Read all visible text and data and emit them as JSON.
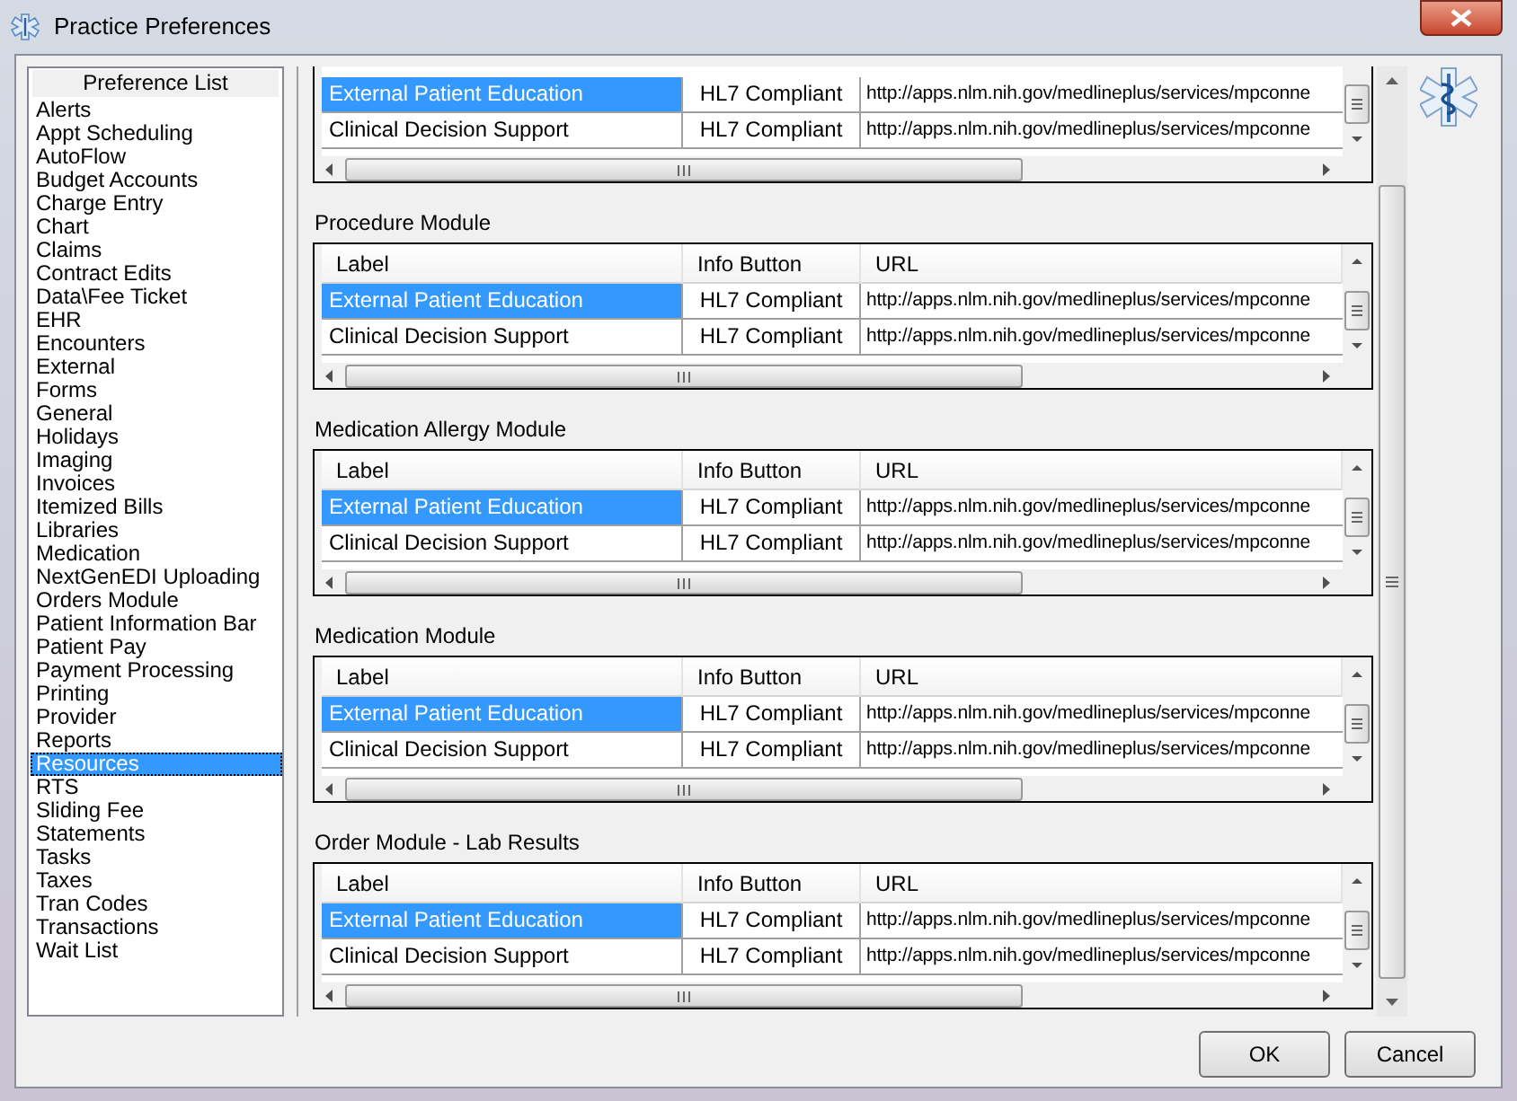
{
  "window": {
    "title": "Practice Preferences"
  },
  "preference_list": {
    "heading": "Preference List",
    "items": [
      {
        "label": "Alerts",
        "selected": false
      },
      {
        "label": "Appt Scheduling",
        "selected": false
      },
      {
        "label": "AutoFlow",
        "selected": false
      },
      {
        "label": "Budget Accounts",
        "selected": false
      },
      {
        "label": "Charge Entry",
        "selected": false
      },
      {
        "label": "Chart",
        "selected": false
      },
      {
        "label": "Claims",
        "selected": false
      },
      {
        "label": "Contract Edits",
        "selected": false
      },
      {
        "label": "Data\\Fee Ticket",
        "selected": false
      },
      {
        "label": "EHR",
        "selected": false
      },
      {
        "label": "Encounters",
        "selected": false
      },
      {
        "label": "External",
        "selected": false
      },
      {
        "label": "Forms",
        "selected": false
      },
      {
        "label": "General",
        "selected": false
      },
      {
        "label": "Holidays",
        "selected": false
      },
      {
        "label": "Imaging",
        "selected": false
      },
      {
        "label": "Invoices",
        "selected": false
      },
      {
        "label": "Itemized Bills",
        "selected": false
      },
      {
        "label": "Libraries",
        "selected": false
      },
      {
        "label": "Medication",
        "selected": false
      },
      {
        "label": "NextGenEDI Uploading",
        "selected": false
      },
      {
        "label": "Orders Module",
        "selected": false
      },
      {
        "label": "Patient Information Bar",
        "selected": false
      },
      {
        "label": "Patient Pay",
        "selected": false
      },
      {
        "label": "Payment Processing",
        "selected": false
      },
      {
        "label": "Printing",
        "selected": false
      },
      {
        "label": "Provider",
        "selected": false
      },
      {
        "label": "Reports",
        "selected": false
      },
      {
        "label": "Resources",
        "selected": true
      },
      {
        "label": "RTS",
        "selected": false
      },
      {
        "label": "Sliding Fee",
        "selected": false
      },
      {
        "label": "Statements",
        "selected": false
      },
      {
        "label": "Tasks",
        "selected": false
      },
      {
        "label": "Taxes",
        "selected": false
      },
      {
        "label": "Tran Codes",
        "selected": false
      },
      {
        "label": "Transactions",
        "selected": false
      },
      {
        "label": "Wait List",
        "selected": false
      }
    ]
  },
  "sections": [
    {
      "rows": [
        {
          "label": "External Patient Education",
          "info_button": "HL7 Compliant",
          "url": "http://apps.nlm.nih.gov/medlineplus/services/mpconne",
          "selected": true
        },
        {
          "label": "Clinical Decision Support",
          "info_button": "HL7 Compliant",
          "url": "http://apps.nlm.nih.gov/medlineplus/services/mpconne",
          "selected": false
        }
      ]
    },
    {
      "title": "Procedure Module",
      "columns": [
        "Label",
        "Info Button",
        "URL"
      ],
      "rows": [
        {
          "label": "External Patient Education",
          "info_button": "HL7 Compliant",
          "url": "http://apps.nlm.nih.gov/medlineplus/services/mpconne",
          "selected": true
        },
        {
          "label": "Clinical Decision Support",
          "info_button": "HL7 Compliant",
          "url": "http://apps.nlm.nih.gov/medlineplus/services/mpconne",
          "selected": false
        }
      ]
    },
    {
      "title": "Medication Allergy Module",
      "columns": [
        "Label",
        "Info Button",
        "URL"
      ],
      "rows": [
        {
          "label": "External Patient Education",
          "info_button": "HL7 Compliant",
          "url": "http://apps.nlm.nih.gov/medlineplus/services/mpconne",
          "selected": true
        },
        {
          "label": "Clinical Decision Support",
          "info_button": "HL7 Compliant",
          "url": "http://apps.nlm.nih.gov/medlineplus/services/mpconne",
          "selected": false
        }
      ]
    },
    {
      "title": "Medication Module",
      "columns": [
        "Label",
        "Info Button",
        "URL"
      ],
      "rows": [
        {
          "label": "External Patient Education",
          "info_button": "HL7 Compliant",
          "url": "http://apps.nlm.nih.gov/medlineplus/services/mpconne",
          "selected": true
        },
        {
          "label": "Clinical Decision Support",
          "info_button": "HL7 Compliant",
          "url": "http://apps.nlm.nih.gov/medlineplus/services/mpconne",
          "selected": false
        }
      ]
    },
    {
      "title": "Order Module - Lab Results",
      "columns": [
        "Label",
        "Info Button",
        "URL"
      ],
      "rows": [
        {
          "label": "External Patient Education",
          "info_button": "HL7 Compliant",
          "url": "http://apps.nlm.nih.gov/medlineplus/services/mpconne",
          "selected": true
        },
        {
          "label": "Clinical Decision Support",
          "info_button": "HL7 Compliant",
          "url": "http://apps.nlm.nih.gov/medlineplus/services/mpconne",
          "selected": false
        }
      ]
    }
  ],
  "buttons": [
    "OK",
    "Cancel"
  ]
}
